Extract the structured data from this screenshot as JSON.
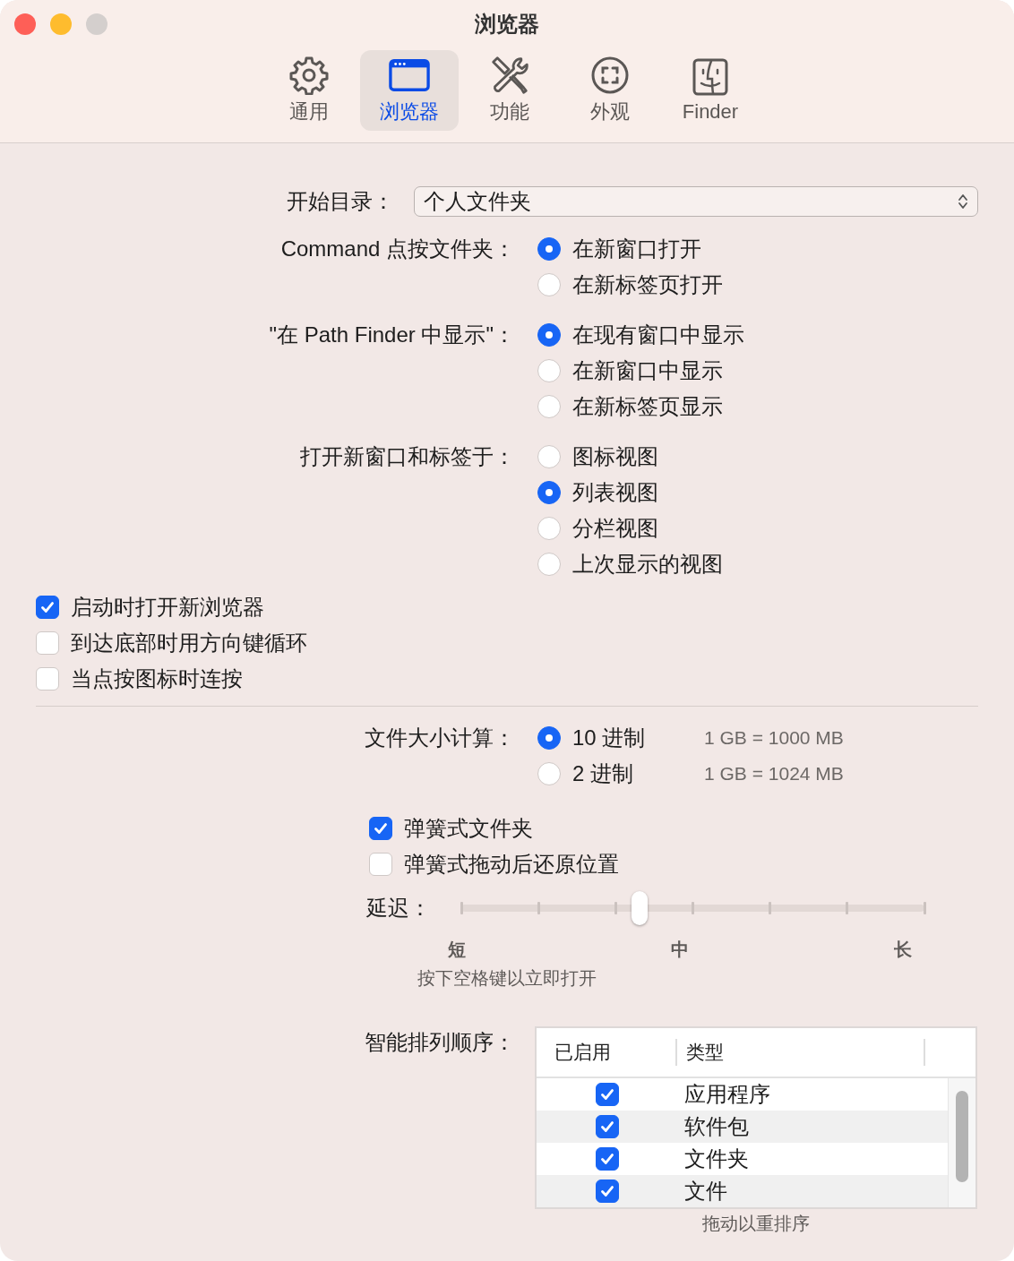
{
  "window": {
    "title": "浏览器"
  },
  "toolbar": [
    {
      "label": "通用",
      "kind": "gear",
      "selected": false
    },
    {
      "label": "浏览器",
      "kind": "browser",
      "selected": true
    },
    {
      "label": "功能",
      "kind": "tools",
      "selected": false
    },
    {
      "label": "外观",
      "kind": "appearance",
      "selected": false
    },
    {
      "label": "Finder",
      "kind": "finder",
      "selected": false
    }
  ],
  "start_folder": {
    "label": "开始目录：",
    "value": "个人文件夹"
  },
  "radio_groups": [
    {
      "label": "Command 点按文件夹：",
      "options": [
        {
          "label": "在新窗口打开",
          "selected": true
        },
        {
          "label": "在新标签页打开",
          "selected": false
        }
      ]
    },
    {
      "label": "\"在 Path Finder 中显示\"：",
      "options": [
        {
          "label": "在现有窗口中显示",
          "selected": true
        },
        {
          "label": "在新窗口中显示",
          "selected": false
        },
        {
          "label": "在新标签页显示",
          "selected": false
        }
      ]
    },
    {
      "label": "打开新窗口和标签于：",
      "options": [
        {
          "label": "图标视图",
          "selected": false
        },
        {
          "label": "列表视图",
          "selected": true
        },
        {
          "label": "分栏视图",
          "selected": false
        },
        {
          "label": "上次显示的视图",
          "selected": false
        }
      ]
    }
  ],
  "checkboxes": [
    {
      "label": "启动时打开新浏览器",
      "checked": true
    },
    {
      "label": "到达底部时用方向键循环",
      "checked": false
    },
    {
      "label": "当点按图标时连按",
      "checked": false
    }
  ],
  "file_size": {
    "label": "文件大小计算：",
    "options": [
      {
        "label": "10 进制",
        "note": "1 GB = 1000 MB",
        "selected": true
      },
      {
        "label": "2 进制",
        "note": "1 GB = 1024 MB",
        "selected": false
      }
    ]
  },
  "spring_checkboxes": [
    {
      "label": "弹簧式文件夹",
      "checked": true
    },
    {
      "label": "弹簧式拖动后还原位置",
      "checked": false
    }
  ],
  "delay": {
    "label": "延迟：",
    "level": 0.37,
    "tick_labels": [
      "短",
      "中",
      "长"
    ],
    "hint": "按下空格键以立即打开"
  },
  "smart_sort": {
    "label": "智能排列顺序：",
    "columns": [
      "已启用",
      "类型"
    ],
    "rows": [
      {
        "type": "应用程序",
        "checked": true
      },
      {
        "type": "软件包",
        "checked": true
      },
      {
        "type": "文件夹",
        "checked": true
      },
      {
        "type": "文件",
        "checked": true
      }
    ],
    "hint": "拖动以重排序"
  }
}
